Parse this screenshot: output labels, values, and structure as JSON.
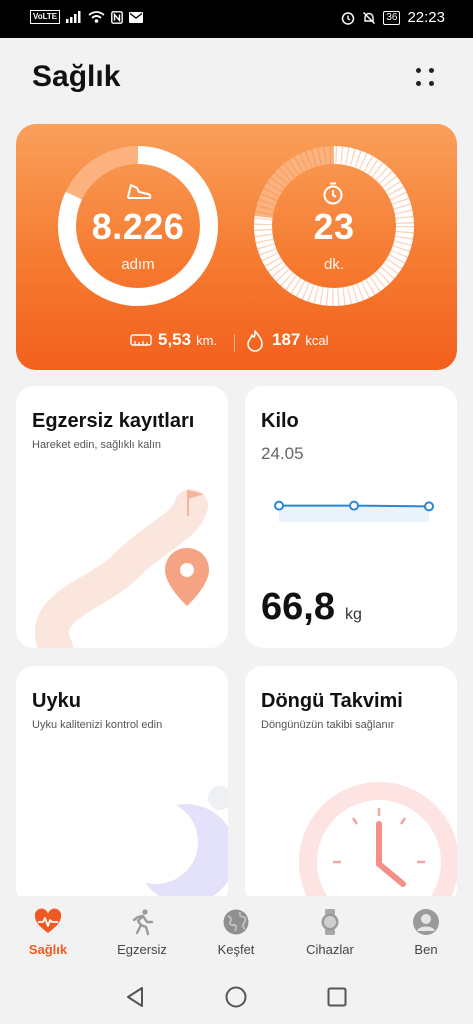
{
  "status_bar": {
    "volte": "VoLTE",
    "battery": "36",
    "time": "22:23"
  },
  "header": {
    "title": "Sağlık"
  },
  "activity": {
    "steps": {
      "value": "8.226",
      "unit": "adım",
      "progress": 0.82
    },
    "minutes": {
      "value": "23",
      "unit": "dk.",
      "progress": 0.77
    },
    "distance": {
      "value": "5,53",
      "unit": "km."
    },
    "calories": {
      "value": "187",
      "unit": "kcal"
    },
    "colors": {
      "ring_fill": "#ffffff",
      "ring_track": "#fbb27e",
      "card": "#f67b31"
    }
  },
  "cards": {
    "exercise": {
      "title": "Egzersiz kayıtları",
      "subtitle": "Hareket edin, sağlıklı kalın"
    },
    "weight": {
      "title": "Kilo",
      "date": "24.05",
      "value": "66,8",
      "unit": "kg",
      "trend": [
        66.9,
        66.9,
        66.8
      ]
    },
    "sleep": {
      "title": "Uyku",
      "subtitle": "Uyku kalitenizi kontrol edin"
    },
    "cycle": {
      "title": "Döngü Takvimi",
      "subtitle": "Döngünüzün takibi sağlanır"
    }
  },
  "bottom_nav": {
    "items": [
      {
        "label": "Sağlık",
        "icon": "heart-pulse-icon",
        "active": true
      },
      {
        "label": "Egzersiz",
        "icon": "runner-icon",
        "active": false
      },
      {
        "label": "Keşfet",
        "icon": "globe-icon",
        "active": false
      },
      {
        "label": "Cihazlar",
        "icon": "watch-icon",
        "active": false
      },
      {
        "label": "Ben",
        "icon": "profile-icon",
        "active": false
      }
    ],
    "colors": {
      "active": "#f05a22",
      "inactive": "#9a9a9a"
    }
  }
}
